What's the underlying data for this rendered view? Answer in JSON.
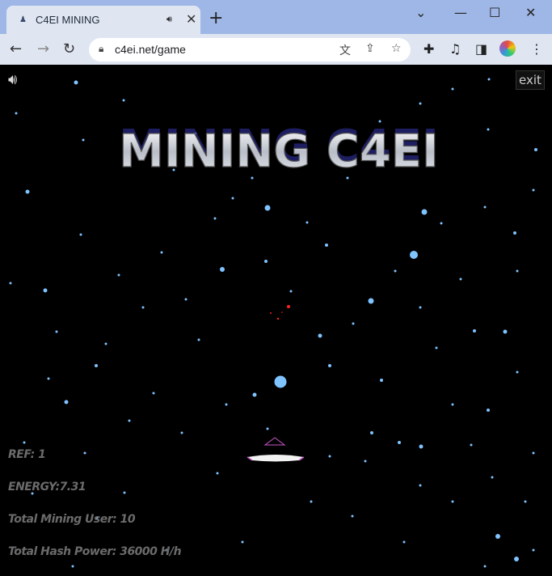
{
  "browser": {
    "tab_title": "C4EI MINING",
    "tab_audio_icon": "speaker-icon",
    "url": "c4ei.net/game"
  },
  "game": {
    "title": "MINING C4EI",
    "exit_label": "exit",
    "hud": {
      "ref": "REF: 1",
      "energy": "ENERGY:7.31",
      "mining_users": "Total Mining User: 10",
      "hash_power": "Total Hash Power: 36000 H/h"
    },
    "colors": {
      "background": "#000000",
      "star": "#7fc3ff",
      "title_fill": "#cfd3da",
      "title_glow": "#3b2f8f",
      "hud_text": "#6b6b6b",
      "ship_accent": "#c857c8",
      "enemy": "#ff2020"
    }
  }
}
